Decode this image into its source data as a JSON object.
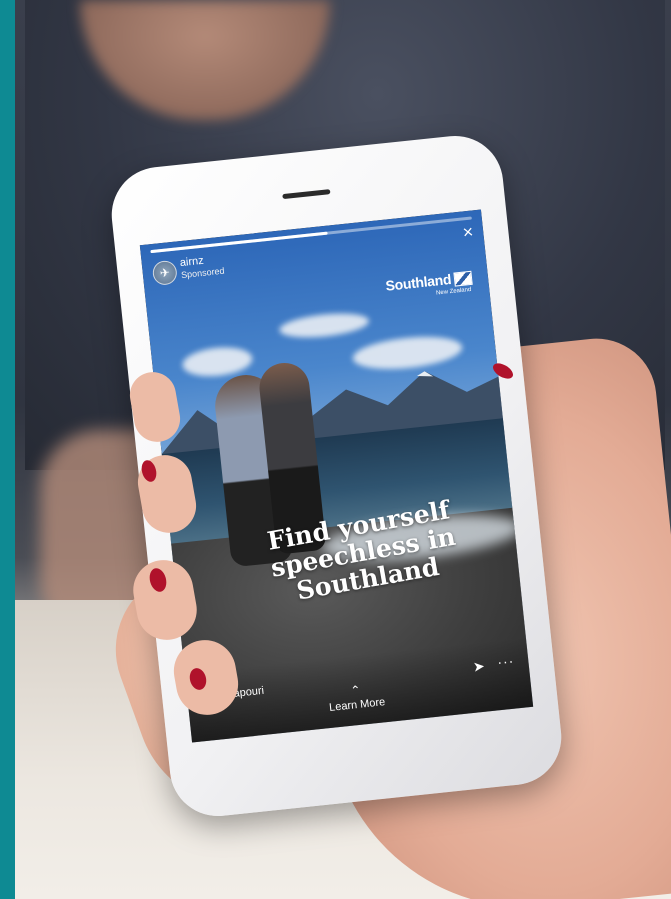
{
  "story": {
    "account_name": "airnz",
    "account_subtitle": "Sponsored",
    "avatar_glyph": "✈",
    "close_glyph": "×",
    "brand_name": "Southland",
    "brand_tagline": "New Zealand",
    "headline": "Find yourself speechless in Southland",
    "location": "Manapouri",
    "share_glyph": "➤",
    "more_glyph": "···",
    "chevron_glyph": "⌃",
    "cta_label": "Learn More",
    "progress_fraction": 0.55
  },
  "colors": {
    "accent_bar": "#0e8a93",
    "nail_polish": "#b0122b",
    "phone_body": "#f1f1f3"
  },
  "icons": [
    "avatar-icon",
    "close-icon",
    "location-pin-icon",
    "share-icon",
    "more-icon",
    "chevron-up-icon"
  ]
}
